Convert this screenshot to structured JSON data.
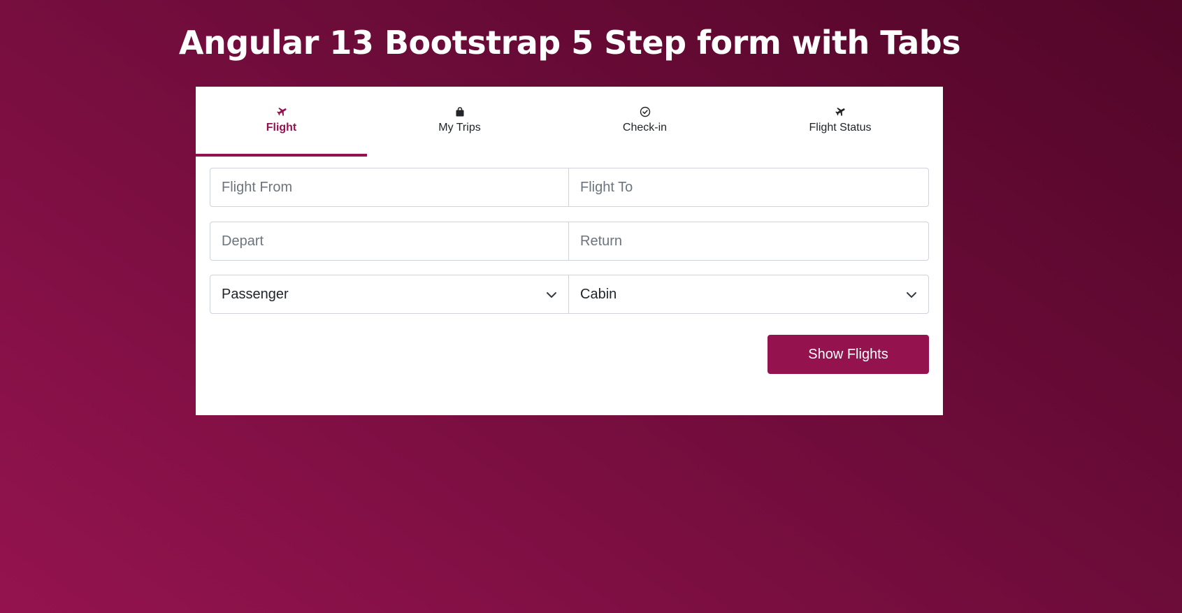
{
  "page": {
    "title": "Angular 13 Bootstrap 5 Step form with Tabs"
  },
  "tabs": [
    {
      "label": "Flight",
      "icon": "airplane-icon",
      "active": true
    },
    {
      "label": "My Trips",
      "icon": "bag-icon",
      "active": false
    },
    {
      "label": "Check-in",
      "icon": "check-circle-icon",
      "active": false
    },
    {
      "label": "Flight Status",
      "icon": "airplane-icon",
      "active": false
    }
  ],
  "form": {
    "flight_from_placeholder": "Flight From",
    "flight_to_placeholder": "Flight To",
    "depart_placeholder": "Depart",
    "return_placeholder": "Return",
    "passenger_selected": "Passenger",
    "cabin_selected": "Cabin",
    "submit_label": "Show Flights"
  },
  "colors": {
    "accent": "#94134f",
    "background_start": "#520628",
    "background_end": "#94134f"
  }
}
